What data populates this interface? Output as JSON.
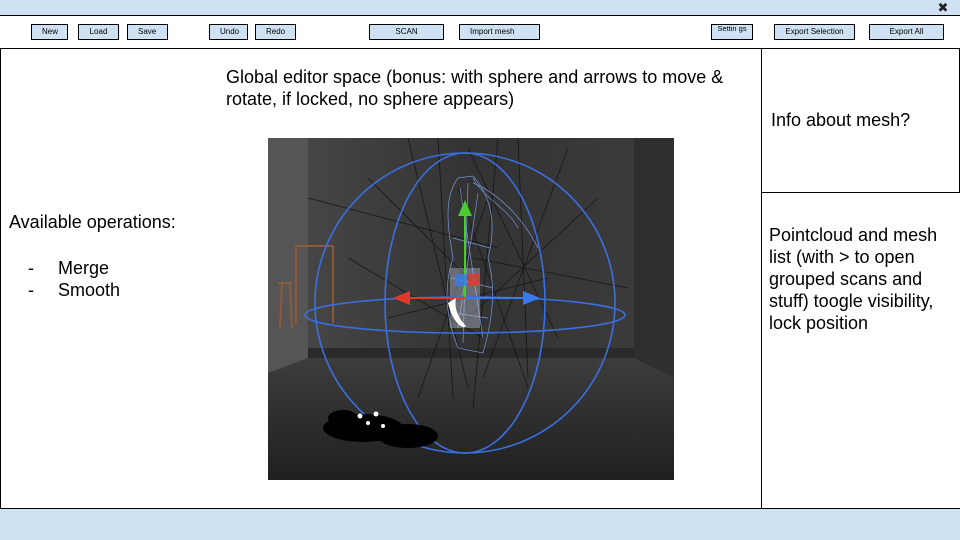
{
  "toolbar": {
    "buttons": {
      "new": "New",
      "load": "Load",
      "save": "Save",
      "undo": "Undo",
      "redo": "Redo",
      "scan": "SCAN",
      "import_mesh": "Import mesh",
      "settings": "Settin gs",
      "export_selection": "Export Selection",
      "export_all": "Export All"
    },
    "close_icon": "close-icon"
  },
  "left_panel": {
    "title": "Available operations:",
    "operations": [
      {
        "bullet": "-",
        "label": "Merge"
      },
      {
        "bullet": "-",
        "label": "Smooth"
      }
    ]
  },
  "center_panel": {
    "description": "Global editor space (bonus: with sphere and arrows to move & rotate, if locked, no sphere appears)"
  },
  "right_panel": {
    "info": "Info about mesh?",
    "list_description": "Pointcloud and mesh list (with > to open grouped scans and stuff) toogle visibility, lock position"
  },
  "colors": {
    "bar_fill": "#cfe2f3",
    "gizmo_ring": "#3a6fe0",
    "axis_x": "#e03a2a",
    "axis_y": "#4ccc30",
    "axis_z": "#3a7af0"
  }
}
